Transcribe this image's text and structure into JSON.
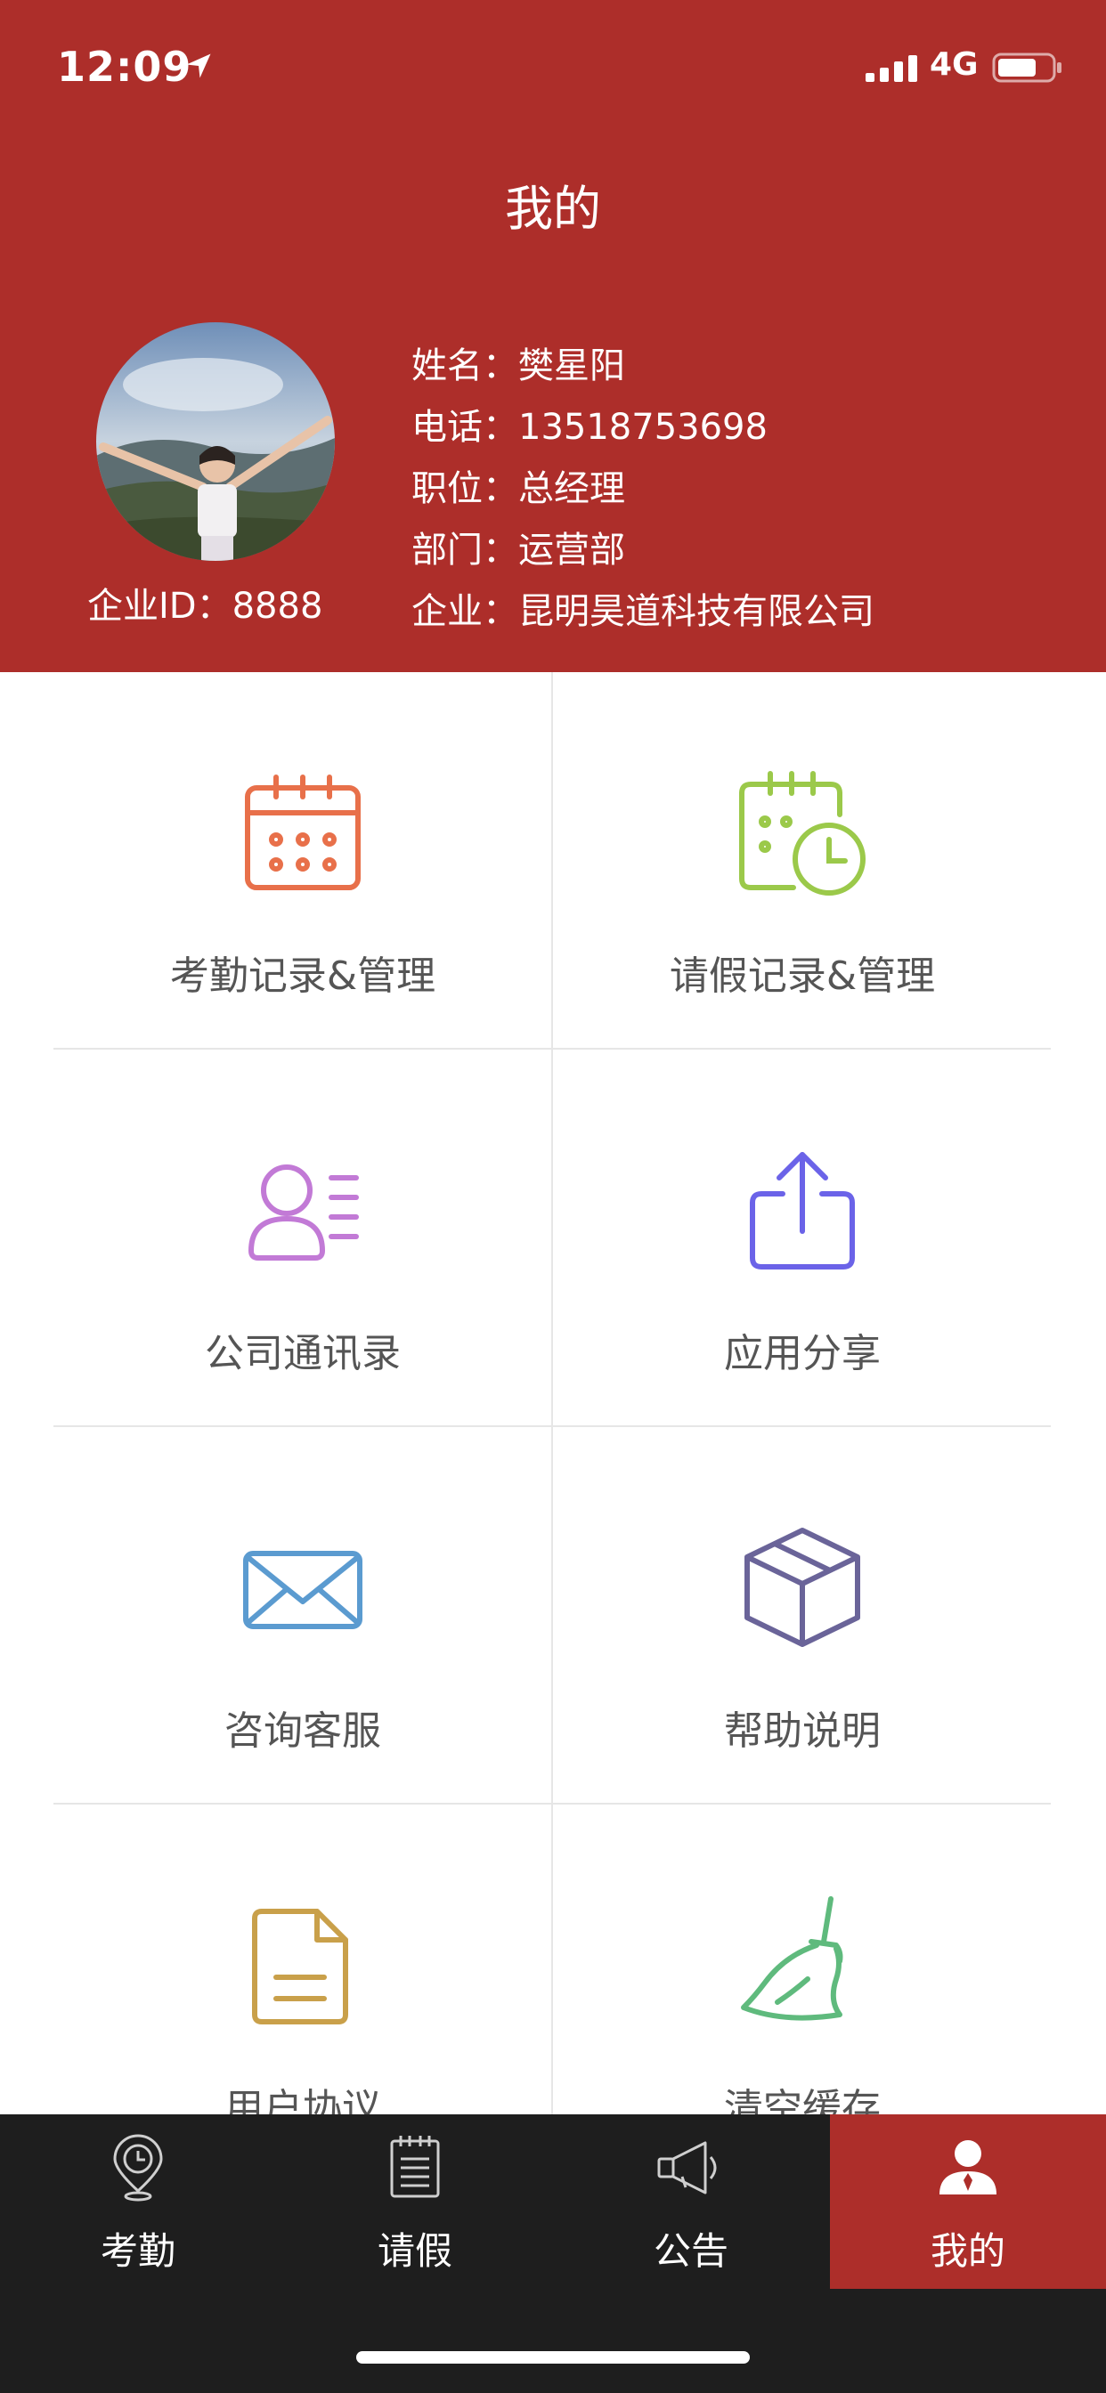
{
  "status": {
    "time": "12:09",
    "network": "4G"
  },
  "header": {
    "title": "我的"
  },
  "profile": {
    "company_id": "企业ID：8888",
    "fields": [
      {
        "label": "姓名：",
        "value": "樊星阳"
      },
      {
        "label": "电话：",
        "value": "13518753698"
      },
      {
        "label": "职位：",
        "value": "总经理"
      },
      {
        "label": "部门：",
        "value": "运营部"
      },
      {
        "label": "企业：",
        "value": "昆明昊道科技有限公司"
      }
    ]
  },
  "menu": [
    {
      "label": "考勤记录&管理",
      "icon": "calendar-icon",
      "color": "#e8704a"
    },
    {
      "label": "请假记录&管理",
      "icon": "calendar-clock-icon",
      "color": "#9bc94a"
    },
    {
      "label": "公司通讯录",
      "icon": "contacts-icon",
      "color": "#c27ad6"
    },
    {
      "label": "应用分享",
      "icon": "share-icon",
      "color": "#6b63e8"
    },
    {
      "label": "咨询客服",
      "icon": "mail-icon",
      "color": "#5b9bd0"
    },
    {
      "label": "帮助说明",
      "icon": "box-icon",
      "color": "#6a6499"
    },
    {
      "label": "用户协议",
      "icon": "document-icon",
      "color": "#c9a04a"
    },
    {
      "label": "清空缓存",
      "icon": "broom-icon",
      "color": "#5fba7d"
    }
  ],
  "tabs": [
    {
      "label": "考勤",
      "icon": "location-clock-icon"
    },
    {
      "label": "请假",
      "icon": "notepad-icon"
    },
    {
      "label": "公告",
      "icon": "megaphone-icon"
    },
    {
      "label": "我的",
      "icon": "user-icon",
      "active": true
    }
  ],
  "colors": {
    "primary": "#ad2e2a",
    "tabbar": "#1e1e1e"
  }
}
